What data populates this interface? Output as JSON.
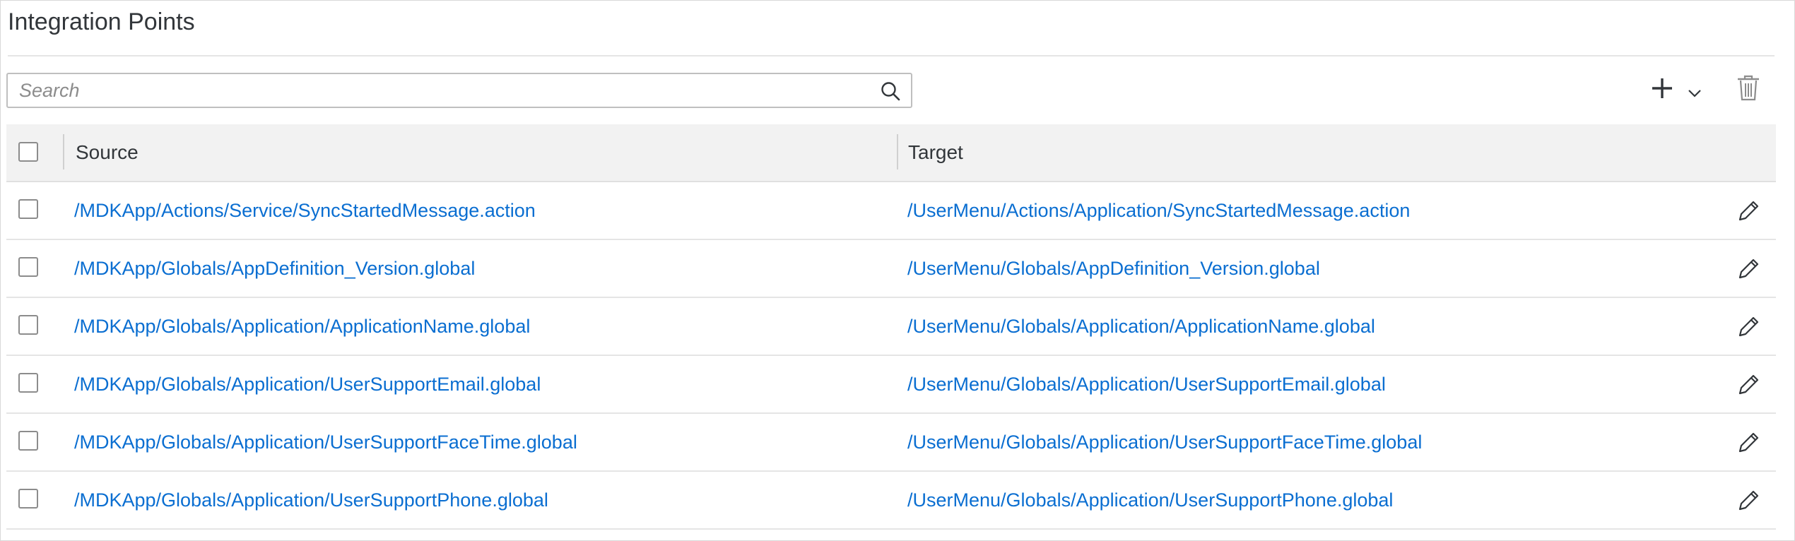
{
  "page": {
    "title": "Integration Points"
  },
  "search": {
    "placeholder": "Search",
    "value": ""
  },
  "icons": {
    "search": "search-icon",
    "add": "plus-icon",
    "add_menu": "chevron-down-icon",
    "delete": "trash-icon",
    "edit": "pencil-icon"
  },
  "colors": {
    "link": "#0a6ed1",
    "header_bg": "#f2f2f2",
    "text": "#32363a"
  },
  "table": {
    "columns": {
      "source": "Source",
      "target": "Target"
    },
    "rows": [
      {
        "source": "/MDKApp/Actions/Service/SyncStartedMessage.action",
        "target": "/UserMenu/Actions/Application/SyncStartedMessage.action"
      },
      {
        "source": "/MDKApp/Globals/AppDefinition_Version.global",
        "target": "/UserMenu/Globals/AppDefinition_Version.global"
      },
      {
        "source": "/MDKApp/Globals/Application/ApplicationName.global",
        "target": "/UserMenu/Globals/Application/ApplicationName.global"
      },
      {
        "source": "/MDKApp/Globals/Application/UserSupportEmail.global",
        "target": "/UserMenu/Globals/Application/UserSupportEmail.global"
      },
      {
        "source": "/MDKApp/Globals/Application/UserSupportFaceTime.global",
        "target": "/UserMenu/Globals/Application/UserSupportFaceTime.global"
      },
      {
        "source": "/MDKApp/Globals/Application/UserSupportPhone.global",
        "target": "/UserMenu/Globals/Application/UserSupportPhone.global"
      }
    ]
  }
}
